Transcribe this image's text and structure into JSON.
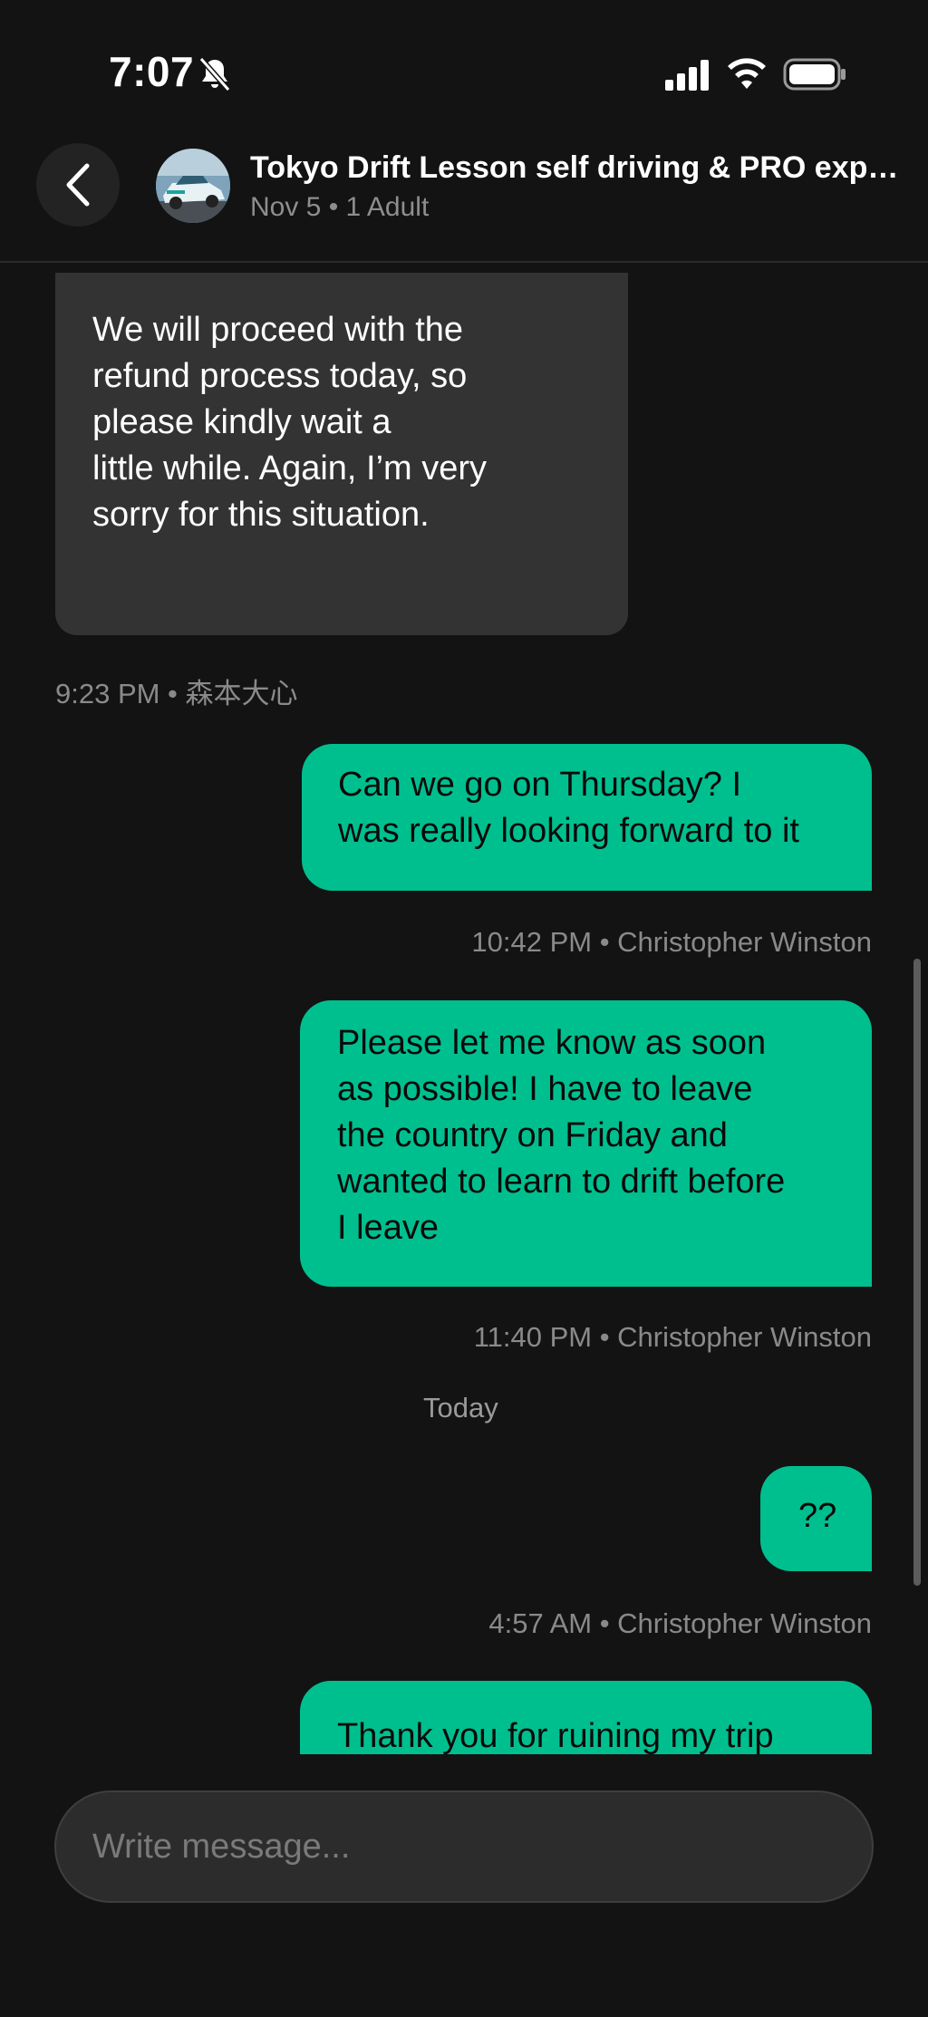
{
  "status_bar": {
    "time": "7:07",
    "icons": [
      "bell-slash-icon",
      "signal-icon",
      "wifi-icon",
      "battery-icon"
    ]
  },
  "header": {
    "back_icon": "chevron-left-icon",
    "title": "Tokyo Drift Lesson self driving & PRO expe...",
    "subtitle": "Nov 5 • 1 Adult"
  },
  "messages": [
    {
      "direction": "incoming",
      "lines": [
        "We will proceed with the",
        "refund process today, so",
        "please kindly wait a",
        "little while. Again, I’m very",
        "sorry for this situation."
      ],
      "meta": "9:23 PM • 森本大心"
    },
    {
      "direction": "outgoing",
      "lines": [
        "Can we go on Thursday? I",
        "was really looking forward to it"
      ],
      "meta": "10:42 PM • Christopher Winston"
    },
    {
      "direction": "outgoing",
      "lines": [
        "Please let me know as soon",
        "as possible! I have to leave",
        "the country on Friday and",
        "wanted to learn to drift before",
        "I leave"
      ],
      "meta": "11:40 PM • Christopher Winston"
    },
    {
      "day_separator": "Today"
    },
    {
      "direction": "outgoing",
      "lines": [
        "??"
      ],
      "meta": "4:57 AM • Christopher Winston"
    },
    {
      "direction": "outgoing",
      "lines": [
        "Thank you for ruining my trip"
      ]
    }
  ],
  "composer": {
    "placeholder": "Write message..."
  },
  "colors": {
    "background": "#131313",
    "incoming_bubble": "#333333",
    "outgoing_bubble": "#00bf8f",
    "meta_text": "#8a8a8a"
  }
}
